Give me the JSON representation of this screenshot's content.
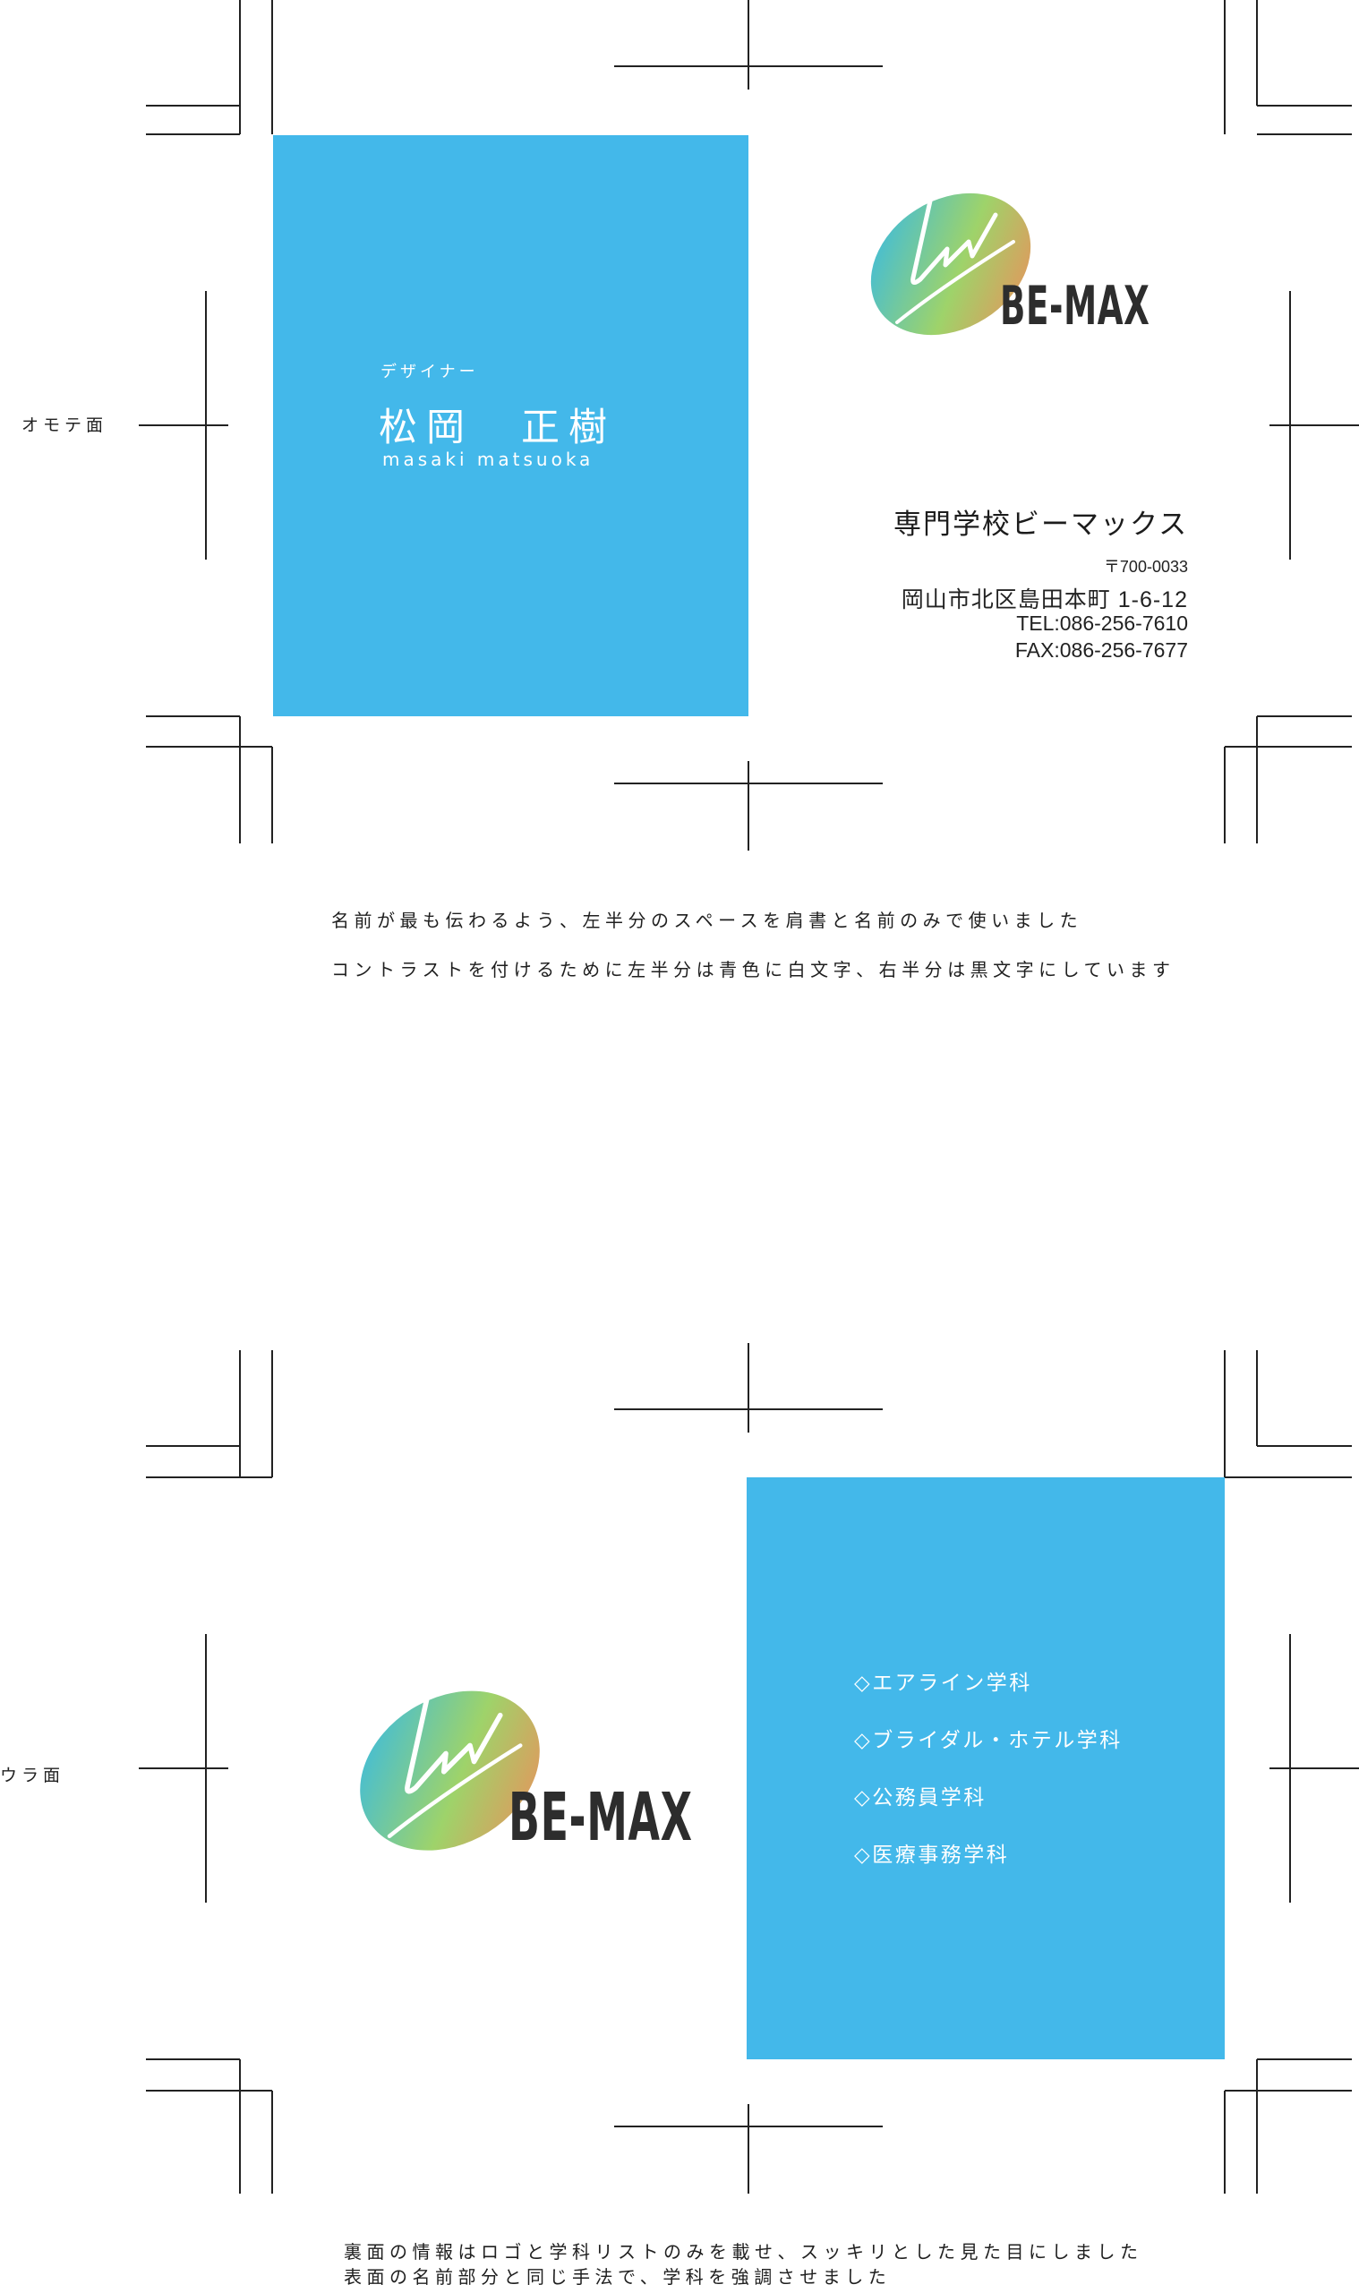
{
  "front": {
    "side_label": "オモテ面",
    "role": "デザイナー",
    "name": "松岡　正樹",
    "romaji": "masaki matsuoka",
    "logo_text": "BE-MAX",
    "school": "専門学校ビーマックス",
    "postal": "〒700-0033",
    "address": "岡山市北区島田本町 1-6-12",
    "tel": "TEL:086-256-7610",
    "fax": "FAX:086-256-7677"
  },
  "front_notes": [
    "名前が最も伝わるよう、左半分のスペースを肩書と名前のみで使いました",
    "コントラストを付けるために左半分は青色に白文字、右半分は黒文字にしています"
  ],
  "back": {
    "side_label": "ウラ面",
    "logo_text": "BE-MAX",
    "departments": [
      "◇エアライン学科",
      "◇ブライダル・ホテル学科",
      "◇公務員学科",
      "◇医療事務学科"
    ]
  },
  "back_notes": [
    "裏面の情報はロゴと学科リストのみを載せ、スッキリとした見た目にしました",
    "表面の名前部分と同じ手法で、学科を強調させました"
  ],
  "colors": {
    "card_blue": "#43b8ea",
    "text_dark": "#1a1a1a",
    "logo_gradient": [
      "#2fb8ee",
      "#9ed36a",
      "#f28a5a"
    ]
  }
}
